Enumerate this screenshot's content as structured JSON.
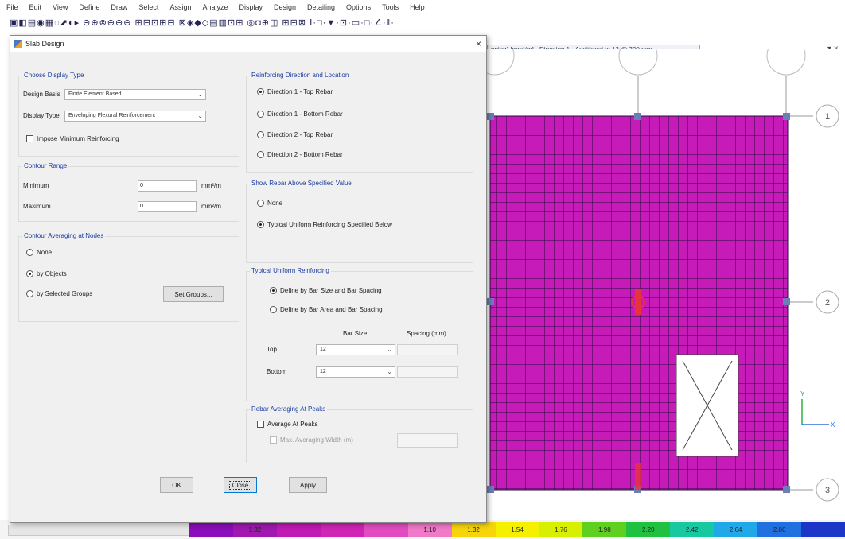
{
  "menu": [
    "File",
    "Edit",
    "View",
    "Define",
    "Draw",
    "Select",
    "Assign",
    "Analyze",
    "Display",
    "Design",
    "Detailing",
    "Options",
    "Tools",
    "Help"
  ],
  "toolbar_glyphs": "▣◧▤◉▦◌⬈◐▸ ⊖⊕⊗⊕⊖⊖ ⊞⊟⊡⊞⊟ ⊠◈◆◇▤▥⊡⊞ ◎◘⊕◫ ⊞⊟⊠ Ⅰ·□·▼·⊡·▭·□·∠·‖·",
  "doc_tab": {
    "label": "pping) [mm²/m] - Direction 1 - Additional to 12 @ 200 mm",
    "close": "▾ ×"
  },
  "legend": {
    "values": [
      "",
      "1.32",
      "",
      "",
      "",
      "1.10",
      "1.32",
      "1.54",
      "1.76",
      "1.98",
      "2.20",
      "2.42",
      "2.64",
      "2.86",
      ""
    ],
    "colors": [
      "#8c0dbb",
      "#a118b0",
      "#c01ab4",
      "#d025b4",
      "#e24cc0",
      "#f07ac8",
      "#f6d50a",
      "#f5f000",
      "#d9ef00",
      "#60d020",
      "#20c040",
      "#18c8a0",
      "#20a8e8",
      "#2070e0",
      "#1c36c8"
    ]
  },
  "canvas": {
    "grid_labels": [
      "1",
      "2",
      "3"
    ],
    "axis_labels": {
      "x": "X",
      "y": "Y"
    }
  },
  "dialog": {
    "title": "Slab Design",
    "close": "×",
    "display_type_group": {
      "title": "Choose Display Type",
      "design_basis_label": "Design Basis",
      "design_basis_value": "Finite Element Based",
      "display_type_label": "Display Type",
      "display_type_value": "Enveloping Flexural Reinforcement",
      "impose_min_label": "Impose Minimum Reinforcing"
    },
    "contour_range_group": {
      "title": "Contour Range",
      "minimum_label": "Minimum",
      "minimum_value": "0",
      "maximum_label": "Maximum",
      "maximum_value": "0",
      "unit": "mm²/m"
    },
    "contour_avg_group": {
      "title": "Contour Averaging at Nodes",
      "none_label": "None",
      "by_objects_label": "by Objects",
      "by_groups_label": "by Selected Groups",
      "set_groups_label": "Set Groups..."
    },
    "rebar_dir_group": {
      "title": "Reinforcing Direction and Location",
      "options": [
        "Direction 1 - Top Rebar",
        "Direction 1 - Bottom Rebar",
        "Direction 2 - Top Rebar",
        "Direction 2 - Bottom Rebar"
      ]
    },
    "show_rebar_group": {
      "title": "Show Rebar Above Specified Value",
      "none_label": "None",
      "typical_label": "Typical Uniform Reinforcing Specified Below"
    },
    "typical_group": {
      "title": "Typical Uniform Reinforcing",
      "bar_size_spacing_label": "Define by Bar Size and Bar Spacing",
      "bar_area_spacing_label": "Define by Bar Area and Bar Spacing",
      "bar_size_header": "Bar Size",
      "spacing_header": "Spacing (mm)",
      "top_label": "Top",
      "top_value": "12",
      "bottom_label": "Bottom",
      "bottom_value": "12"
    },
    "rebar_avg_group": {
      "title": "Rebar Averaging At Peaks",
      "average_label": "Average At Peaks",
      "max_width_label": "Max. Averaging Width (m)"
    },
    "buttons": {
      "ok": "OK",
      "close": "Close",
      "apply": "Apply"
    }
  }
}
